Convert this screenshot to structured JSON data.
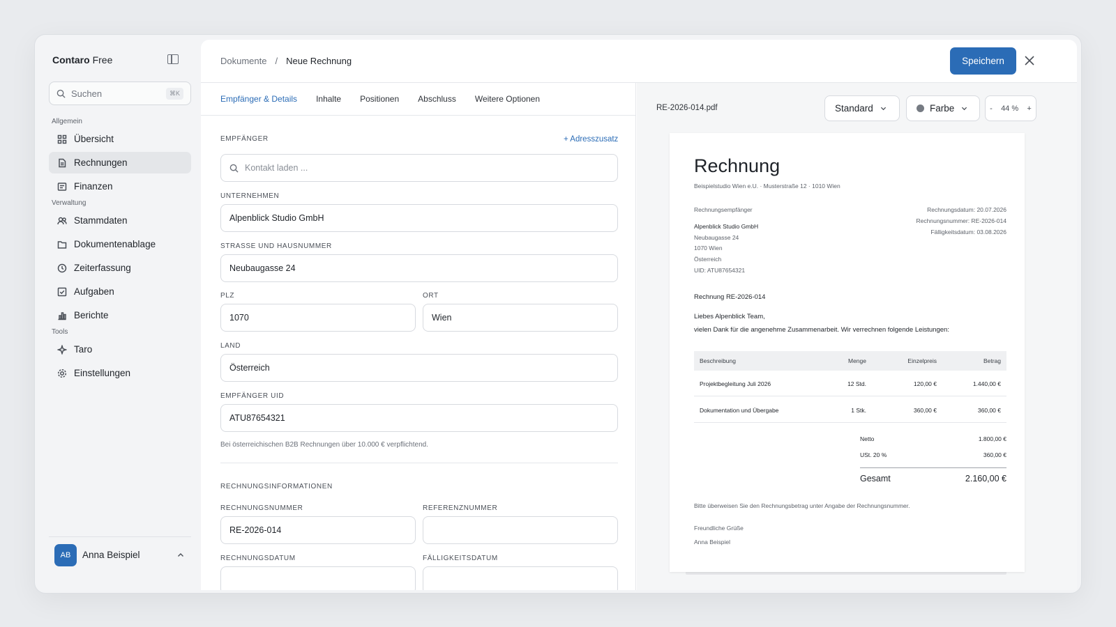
{
  "sidebar": {
    "brand_name": "Contaro",
    "brand_plan": "Free",
    "search_placeholder": "Suchen",
    "search_shortcut": "⌘K",
    "sections": {
      "general": "Allgemein",
      "admin": "Verwaltung",
      "tools": "Tools"
    },
    "items": {
      "overview": "Übersicht",
      "invoices": "Rechnungen",
      "finances": "Finanzen",
      "master_data": "Stammdaten",
      "documents": "Dokumentenablage",
      "time": "Zeiterfassung",
      "tasks": "Aufgaben",
      "reports": "Berichte",
      "taro": "Taro",
      "settings": "Einstellungen"
    },
    "user": {
      "initials": "AB",
      "name": "Anna Beispiel"
    }
  },
  "header": {
    "breadcrumb_parent": "Dokumente",
    "breadcrumb_sep": "/",
    "breadcrumb_current": "Neue Rechnung",
    "save_label": "Speichern"
  },
  "tabs": [
    "Empfänger & Details",
    "Inhalte",
    "Positionen",
    "Abschluss",
    "Weitere Optionen"
  ],
  "form": {
    "recipient_label": "EMPFÄNGER",
    "address_addon": "+ Adresszusatz",
    "contact_placeholder": "Kontakt laden ...",
    "company_label": "UNTERNEHMEN",
    "company_value": "Alpenblick Studio GmbH",
    "street_label": "STRASSE UND HAUSNUMMER",
    "street_value": "Neubaugasse 24",
    "zip_label": "PLZ",
    "zip_value": "1070",
    "city_label": "ORT",
    "city_value": "Wien",
    "country_label": "LAND",
    "country_value": "Österreich",
    "uid_label": "EMPFÄNGER UID",
    "uid_value": "ATU87654321",
    "uid_hint": "Bei österreichischen B2B Rechnungen über 10.000 € verpflichtend.",
    "invoice_info_label": "RECHNUNGSINFORMATIONEN",
    "invoice_no_label": "RECHNUNGSNUMMER",
    "invoice_no_value": "RE-2026-014",
    "reference_label": "REFERENZNUMMER",
    "reference_value": "",
    "invoice_date_label": "RECHNUNGSDATUM",
    "due_date_label": "FÄLLIGKEITSDATUM"
  },
  "preview": {
    "filename": "RE-2026-014.pdf",
    "template": "Standard",
    "color": "Farbe",
    "zoom_minus": "-",
    "zoom": "44 %",
    "zoom_plus": "+",
    "doc": {
      "title": "Rechnung",
      "sender_line": "Beispielstudio Wien e.U. · Musterstraße 12 · 1010 Wien",
      "recipient_heading": "Rechnungsempfänger",
      "recipient_lines": [
        "Alpenblick Studio GmbH",
        "Neubaugasse 24",
        "1070 Wien",
        "Österreich",
        "UID: ATU87654321"
      ],
      "meta_lines": [
        "Rechnungsdatum: 20.07.2026",
        "Rechnungsnummer: RE-2026-014",
        "Fälligkeitsdatum: 03.08.2026"
      ],
      "subject": "Rechnung RE-2026-014",
      "greeting": "Liebes Alpenblick Team,",
      "intro": "vielen Dank für die angenehme Zusammenarbeit. Wir verrechnen folgende Leistungen:",
      "table_headers": [
        "Beschreibung",
        "Menge",
        "Einzelpreis",
        "Betrag"
      ],
      "rows": [
        [
          "Projektbegleitung Juli 2026",
          "12 Std.",
          "120,00 €",
          "1.440,00 €"
        ],
        [
          "Dokumentation und Übergabe",
          "1 Stk.",
          "360,00 €",
          "360,00 €"
        ]
      ],
      "net_label": "Netto",
      "net_value": "1.800,00 €",
      "vat_label": "USt. 20 %",
      "vat_value": "360,00 €",
      "total_label": "Gesamt",
      "total_value": "2.160,00 €",
      "payment_note": "Bitte überweisen Sie den Rechnungsbetrag unter Angabe der Rechnungsnummer.",
      "closing": "Freundliche Grüße",
      "signature": "Anna Beispiel"
    }
  }
}
